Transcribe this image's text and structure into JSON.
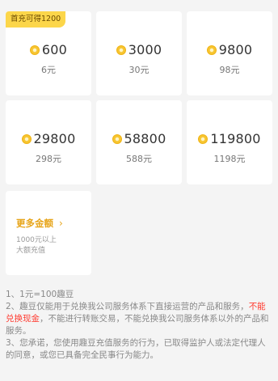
{
  "badge": "首充可得1200",
  "packages": [
    {
      "amount": "600",
      "price": "6元"
    },
    {
      "amount": "3000",
      "price": "30元"
    },
    {
      "amount": "9800",
      "price": "98元"
    },
    {
      "amount": "29800",
      "price": "298元"
    },
    {
      "amount": "58800",
      "price": "588元"
    },
    {
      "amount": "119800",
      "price": "1198元"
    }
  ],
  "more": {
    "title": "更多金额",
    "chevron": "›",
    "line1": "1000元以上",
    "line2": "大额充值"
  },
  "notes": {
    "n1": "1、1元=100趣豆",
    "n2_a": "2、趣豆仅能用于兑换我公司服务体系下直接运营的产品和服务，",
    "n2_red": "不能兑换现金",
    "n2_b": "，不能进行转账交易，不能兑换我公司服务体系以外的产品和服务。",
    "n3": "3、您承诺，您使用趣豆充值服务的行为，已取得监护人或法定代理人的同意，或您已具备完全民事行为能力。"
  },
  "colors": {
    "accent": "#fcd64a",
    "more_title": "#e7a51a",
    "warning": "#ff3b30",
    "coin": "#f7c531"
  },
  "icons": {
    "coin": "coin-icon",
    "chevron": "chevron-right-icon"
  }
}
